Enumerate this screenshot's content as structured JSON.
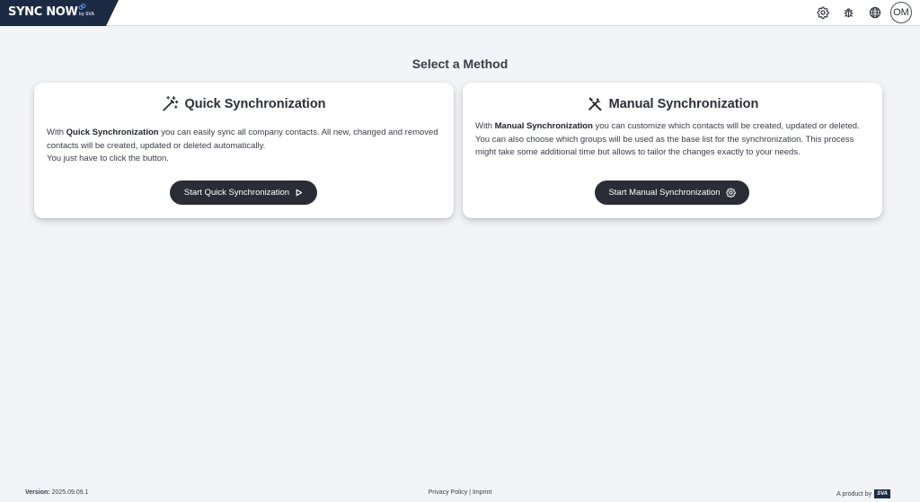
{
  "header": {
    "brand": "SYNC NOW",
    "brand_sub": "by SVA",
    "icons": [
      "settings-icon",
      "bug-icon",
      "globe-icon"
    ],
    "avatar_initials": "OM"
  },
  "main": {
    "title": "Select a Method",
    "quick": {
      "title": "Quick Synchronization",
      "icon": "magic-wand-icon",
      "body_prefix": "With ",
      "body_bold": "Quick Synchronization",
      "body_rest": " you can easily sync all company contacts. All new, changed and removed contacts will be created, updated or deleted automatically.",
      "body_line2": "You just have to click the button.",
      "button_label": "Start Quick Synchronization",
      "button_icon": "play-icon"
    },
    "manual": {
      "title": "Manual Synchronization",
      "icon": "tools-icon",
      "body_prefix": "With ",
      "body_bold": "Manual Synchronization",
      "body_rest": " you can customize which contacts will be created, updated or deleted. You can also choose which groups will be used as the base list for the synchronization. This process might take some additional time but allows to tailor the changes exactly to your needs.",
      "button_label": "Start Manual Synchronization",
      "button_icon": "gear-icon"
    }
  },
  "footer": {
    "version_label": "Version:",
    "version_value": "2025.09.09.1",
    "privacy": "Privacy Policy",
    "separator": "|",
    "imprint": "Imprint",
    "product_by": "A product by",
    "product_brand": "SVA"
  },
  "colors": {
    "brand_navy": "#1d2a44",
    "button_dark": "#2b2d36",
    "background": "#f3f4f7"
  }
}
